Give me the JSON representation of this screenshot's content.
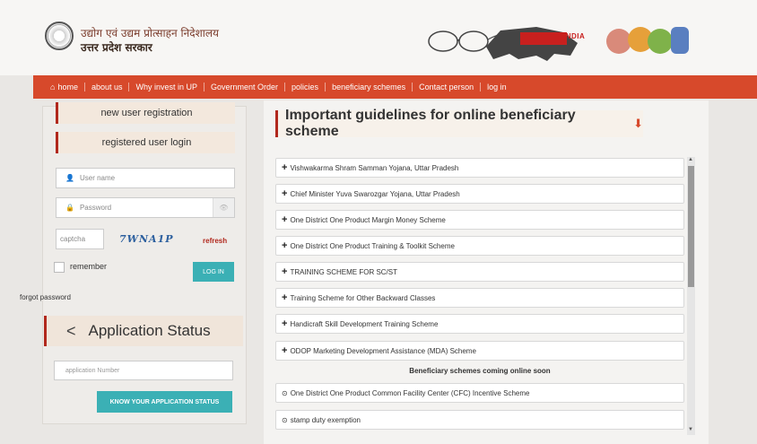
{
  "header": {
    "org_line1": "उद्योग एवं उद्यम प्रोत्साहन निदेशालय",
    "org_line2": "उत्तर प्रदेश सरकार",
    "makeinindia": "MAKE IN INDIA"
  },
  "nav": {
    "items": [
      "home",
      "about us",
      "Why invest in UP",
      "Government Order",
      "policies",
      "beneficiary schemes",
      "Contact person",
      "log in"
    ],
    "color": "#d7492b"
  },
  "login": {
    "new_user": "new user registration",
    "registered_user": "registered user login",
    "username_placeholder": "User name",
    "password_placeholder": "Password",
    "captcha_placeholder": "captcha",
    "captcha_text": "7WNA1P",
    "refresh": "refresh",
    "remember": "remember",
    "login_button": "LOG IN",
    "forgot": "forgot password"
  },
  "status": {
    "title": "Application Status",
    "app_placeholder": "application Number",
    "button": "KNOW YOUR APPLICATION STATUS"
  },
  "main": {
    "title": "Important guidelines for online beneficiary scheme",
    "schemes": [
      "Vishwakarma Shram Samman Yojana, Uttar Pradesh",
      "Chief Minister Yuva Swarozgar Yojana, Uttar Pradesh",
      "One District One Product Margin Money Scheme",
      "One District One Product Training & Toolkit Scheme",
      "TRAINING SCHEME FOR SC/ST",
      "Training Scheme for Other Backward Classes",
      "Handicraft Skill Development Training Scheme",
      "ODOP Marketing Development Assistance (MDA) Scheme"
    ],
    "coming_soon": "Beneficiary schemes coming online soon",
    "upcoming": [
      "One District One Product Common Facility Center (CFC) Incentive Scheme",
      "stamp duty exemption"
    ]
  },
  "colors": {
    "accent": "#b1281d",
    "teal": "#3bb0b5"
  }
}
